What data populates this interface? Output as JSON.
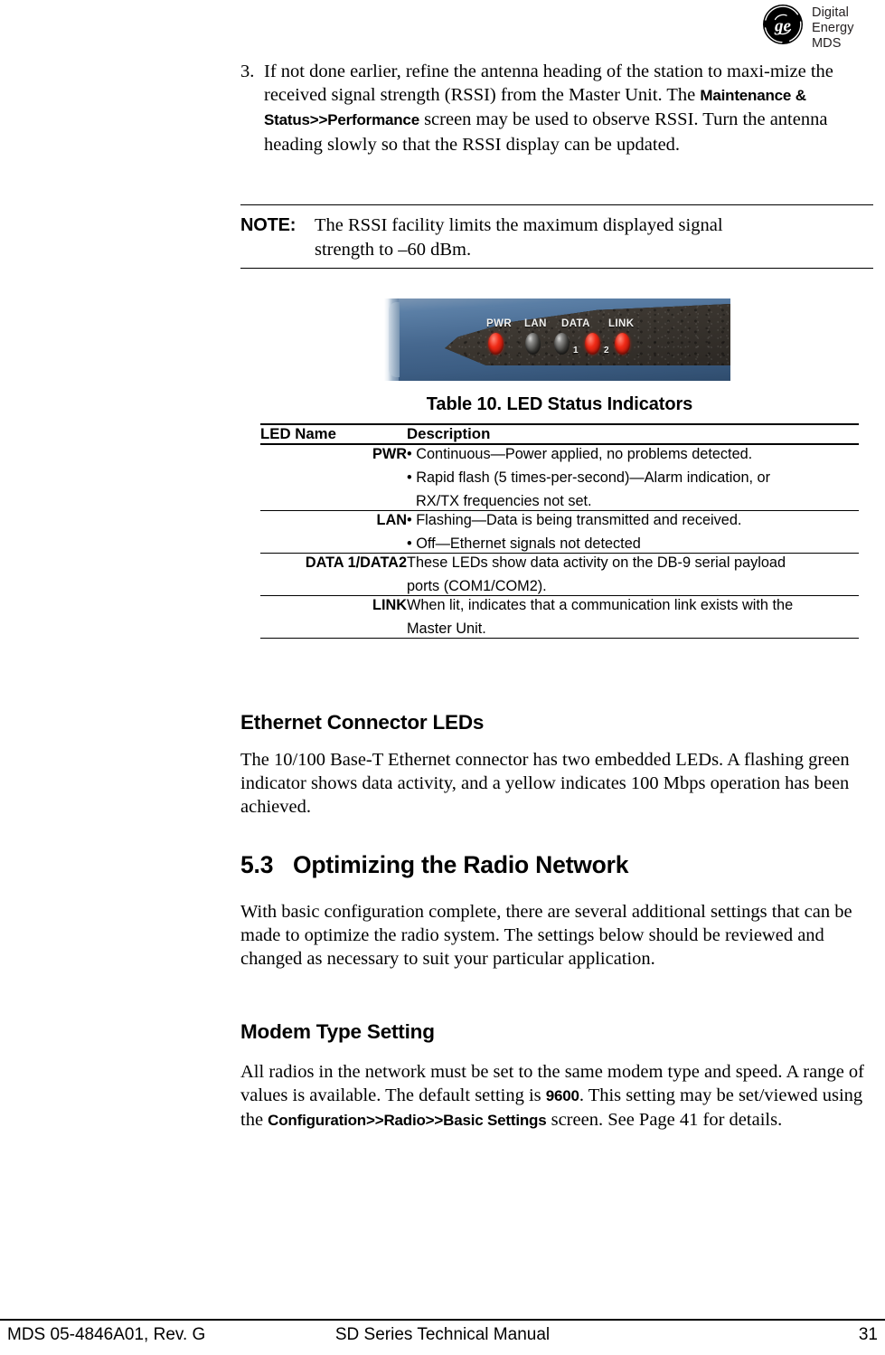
{
  "logo": {
    "mark": "ge-monogram-icon",
    "line1": "Digital Energy",
    "line2": "MDS"
  },
  "step": {
    "number": "3.",
    "text_before": "If not done earlier, refine the antenna heading of the station to maxi-mize the received signal strength (RSSI) from the Master Unit. The ",
    "ui_path": "Maintenance & Status>>Performance",
    "text_after": " screen may be used to observe RSSI. Turn the antenna heading slowly so that the RSSI display can be updated."
  },
  "note": {
    "label": "NOTE:",
    "line1": "The RSSI facility limits the maximum displayed signal",
    "line2": "strength to –60 dBm."
  },
  "photo": {
    "alt": "radio-front-panel-photo",
    "led_labels": [
      "PWR",
      "LAN",
      "DATA",
      "LINK"
    ],
    "led_numbers": [
      "1",
      "2"
    ],
    "led_states": [
      "on",
      "off",
      "off",
      "on",
      "on"
    ],
    "colors": {
      "body": "#3c5d83",
      "panel": "#3a352f",
      "led_on": "#f02a16",
      "led_off": "#3b3a37"
    }
  },
  "table": {
    "title": "Table 10. LED Status Indicators",
    "headers": [
      "LED Name",
      "Description"
    ],
    "rows": [
      {
        "name": "PWR",
        "lines": [
          "• Continuous—Power applied, no problems detected.",
          "• Rapid flash (5 times-per-second)—Alarm indication, or",
          "RX/TX frequencies not set."
        ]
      },
      {
        "name": "LAN",
        "lines": [
          "• Flashing—Data is being transmitted and received.",
          "• Off—Ethernet signals not detected"
        ]
      },
      {
        "name": "DATA 1/DATA2",
        "lines": [
          "These LEDs show data activity on the DB-9 serial payload",
          "ports (COM1/COM2)."
        ]
      },
      {
        "name": "LINK",
        "lines": [
          "When lit, indicates that a communication link exists with the",
          "Master Unit."
        ]
      }
    ]
  },
  "ethernet_section": {
    "heading": "Ethernet Connector LEDs",
    "paragraph": "The 10/100 Base-T Ethernet connector has two embedded LEDs. A flashing green indicator shows data activity, and a yellow indicates 100 Mbps operation has been achieved."
  },
  "optimizing_section": {
    "number": "5.3",
    "heading": "Optimizing the Radio Network",
    "paragraph": "With basic configuration complete, there are several additional settings that can be made to optimize the radio system. The settings below should be reviewed and changed as necessary to suit your particular application."
  },
  "modem_section": {
    "heading": "Modem Type Setting",
    "text_part1": "All radios in the network must be set to the same modem type and speed. A range of values is available. The default setting is ",
    "value_bold": "9600",
    "text_part2": ". This setting may be set/viewed using the ",
    "ui_path": "Configuration>>Radio>>Basic Settings",
    "text_part3": " screen. See Page 41 for details."
  },
  "footer": {
    "left": "MDS 05-4846A01, Rev. G",
    "center": "SD Series Technical Manual",
    "page": "31"
  }
}
